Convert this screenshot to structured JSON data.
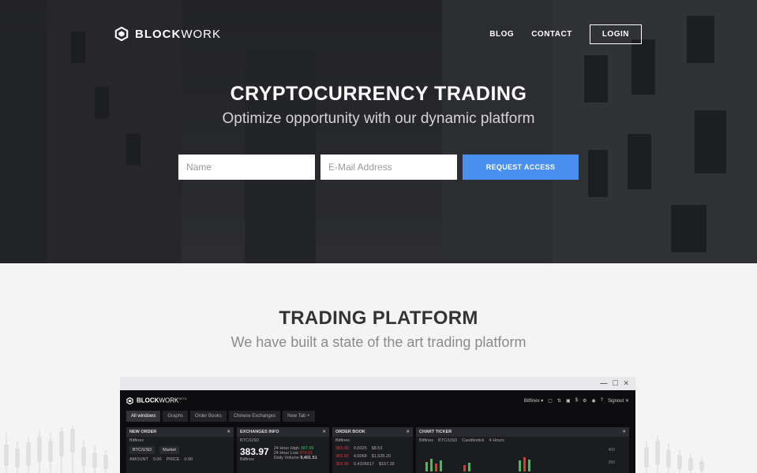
{
  "brand": {
    "bold": "BLOCK",
    "light": "WORK"
  },
  "nav": {
    "blog": "BLOG",
    "contact": "CONTACT",
    "login": "LOGIN"
  },
  "hero": {
    "title": "CRYPTOCURRENCY TRADING",
    "subtitle": "Optimize opportunity with our dynamic platform",
    "name_placeholder": "Name",
    "email_placeholder": "E-Mail Address",
    "cta": "REQUEST ACCESS"
  },
  "section": {
    "title": "TRADING PLATFORM",
    "subtitle": "We have built a state of the art trading platform"
  },
  "colors": {
    "accent": "#4a90f0",
    "hero_bg": "#2f3034",
    "page_bg": "#f4f4f4"
  },
  "app": {
    "chrome": {
      "minimize": "—",
      "maximize": "☐",
      "close": "✕"
    },
    "brand_bold": "BLOCK",
    "brand_light": "WORK",
    "badge": "BETA",
    "exchange": "Bitfinex ▾",
    "signout": "Signout ✕",
    "tabs": [
      "All windows",
      "Graphs",
      "Order Books",
      "Chinese Exchanges",
      "New Tab +"
    ],
    "panels": {
      "new_order": {
        "title": "NEW ORDER",
        "exchange": "Bitfinex",
        "pair": "BTC/USD",
        "type": "Market",
        "amount_label": "AMOUNT",
        "amount": "0.00",
        "price_label": "PRICE",
        "price": "0.00"
      },
      "exchanges_info": {
        "title": "EXCHANGES INFO",
        "pair": "BTC/USD",
        "price": "383.97",
        "exchange": "Bitfinex",
        "rows": [
          {
            "label": "24 Hour High",
            "value": "387.99"
          },
          {
            "label": "24 Hour Low",
            "value": "374.61"
          },
          {
            "label": "Daily Volume",
            "value": "9,401.51"
          }
        ]
      },
      "order_book": {
        "title": "ORDER BOOK",
        "exchange": "Bitfinex",
        "rows": [
          {
            "a": "383.90",
            "b": "0.0025",
            "c": "$8.53"
          },
          {
            "a": "383.92",
            "b": "4.0068",
            "c": "$1,535.20"
          },
          {
            "a": "383.95",
            "b": "0.4106517",
            "c": "$157.35"
          }
        ]
      },
      "chart_ticker": {
        "title": "CHART TICKER",
        "exchange": "Bitfinex",
        "pair": "BTC/USD",
        "type": "Candlestick",
        "interval": "4 Hours",
        "scale_top": "400",
        "scale_mid": "350"
      }
    }
  }
}
